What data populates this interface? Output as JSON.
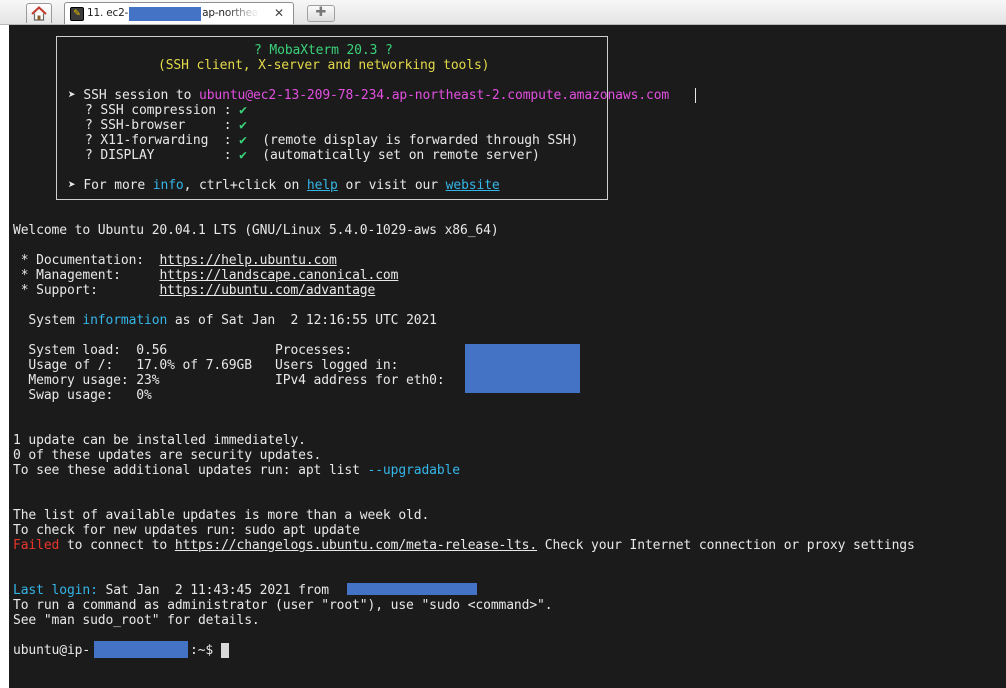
{
  "tabbar": {
    "home_icon": "home-icon",
    "tab": {
      "number_label": "11. ec2-",
      "suffix_label": "ap-northeast",
      "close": "✕",
      "icon": "wrench-icon"
    },
    "new_tab_icon": "✚"
  },
  "banner": {
    "title": "? MobaXterm 20.3 ?",
    "subtitle": "(SSH client, X-server and networking tools)",
    "session_prefix": "➤ SSH session to ",
    "session_user": "ubuntu",
    "session_host": "@ec2-13-209-78-234.ap-northeast-2.compute.amazonaws.com",
    "features": [
      {
        "name": "? SSH compression : ",
        "check": "✔",
        "note": ""
      },
      {
        "name": "? SSH-browser     : ",
        "check": "✔",
        "note": ""
      },
      {
        "name": "? X11-forwarding  : ",
        "check": "✔",
        "note": "  (remote display is forwarded through SSH)"
      },
      {
        "name": "? DISPLAY         : ",
        "check": "✔",
        "note": "  (automatically set on remote server)"
      }
    ],
    "more_prefix": "➤ For more ",
    "more_info": "info",
    "more_mid": ", ctrl+click on ",
    "more_help": "help",
    "more_or": " or visit our ",
    "more_website": "website"
  },
  "motd": {
    "welcome": "Welcome to Ubuntu 20.04.1 LTS (GNU/Linux 5.4.0-1029-aws x86_64)",
    "doc_label": " * Documentation:  ",
    "doc_url": "https://help.ubuntu.com",
    "mgmt_label": " * Management:     ",
    "mgmt_url": "https://landscape.canonical.com",
    "support_label": " * Support:        ",
    "support_url": "https://ubuntu.com/advantage",
    "sysinfo_prefix": "  System ",
    "sysinfo_word": "information",
    "sysinfo_suffix": " as of Sat Jan  2 12:16:55 UTC 2021",
    "stats": [
      "  System load:  0.56              Processes:",
      "  Usage of /:   17.0% of 7.69GB   Users logged in:",
      "  Memory usage: 23%               IPv4 address for eth0:",
      "  Swap usage:   0%"
    ],
    "updates": [
      "1 update can be installed immediately.",
      "0 of these updates are security updates."
    ],
    "apt_prefix": "To see these additional updates run: apt list ",
    "apt_flag": "--upgradable",
    "old_list": "The list of available updates is more than a week old.",
    "check_updates": "To check for new updates run: sudo apt update",
    "failed_word": "Failed",
    "failed_mid": " to connect to ",
    "failed_url": "https://changelogs.ubuntu.com/meta-release-lts.",
    "failed_suffix": " Check your Internet connection or proxy settings",
    "last_login_label": "Last login:",
    "last_login_value": " Sat Jan  2 11:43:45 2021 from ",
    "sudo_line1": "To run a command as administrator (user \"root\"), use \"sudo <command>\".",
    "sudo_line2": "See \"man sudo_root\" for details."
  },
  "prompt": {
    "user_prefix": "ubuntu@ip-",
    "suffix": ":~$"
  },
  "colors": {
    "redaction": "#4472c4",
    "background": "#1b1b1b",
    "accent_cyan": "#35b5e8",
    "accent_magenta": "#e24fe0",
    "accent_green": "#3ad17a",
    "accent_red": "#e8352b"
  }
}
